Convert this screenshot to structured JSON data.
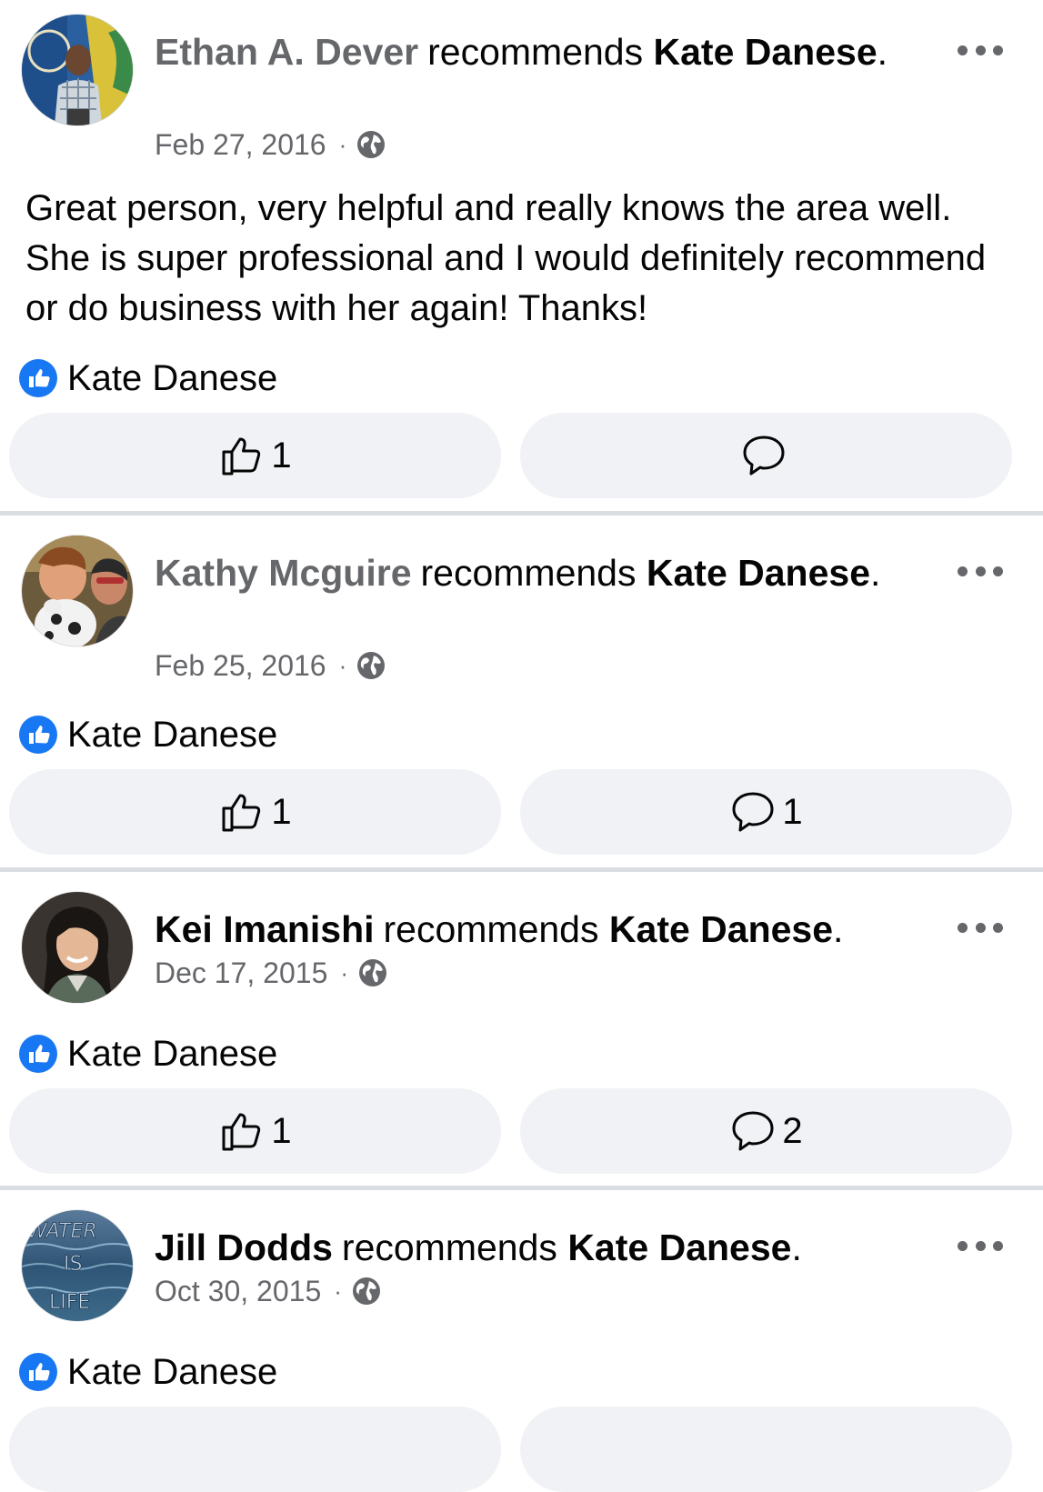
{
  "colors": {
    "accent_blue": "#1877f2",
    "muted_text": "#65676b",
    "button_bg": "#f0f2f5",
    "divider": "#dadde1"
  },
  "posts": [
    {
      "author": "Ethan A. Dever",
      "verb": "recommends",
      "target": "Kate Danese",
      "date": "Feb 27, 2016",
      "privacy_icon": "globe-icon",
      "text": "Great person, very helpful and really knows the area well. She is super professional and I would definitely recommend or do business with her again! Thanks!",
      "recommended_page": "Kate Danese",
      "like_count": "1",
      "comment_count": ""
    },
    {
      "author": "Kathy Mcguire",
      "verb": "recommends",
      "target": "Kate Danese",
      "date": "Feb 25, 2016",
      "privacy_icon": "globe-icon",
      "text": "",
      "recommended_page": "Kate Danese",
      "like_count": "1",
      "comment_count": "1"
    },
    {
      "author": "Kei Imanishi",
      "verb": "recommends",
      "target": "Kate Danese",
      "date": "Dec 17, 2015",
      "privacy_icon": "globe-icon",
      "text": "",
      "recommended_page": "Kate Danese",
      "like_count": "1",
      "comment_count": "2"
    },
    {
      "author": "Jill Dodds",
      "verb": "recommends",
      "target": "Kate Danese",
      "date": "Oct 30, 2015",
      "privacy_icon": "globe-icon",
      "text": "",
      "recommended_page": "Kate Danese",
      "avatar_text": [
        "WATER",
        "IS",
        "LIFE"
      ]
    }
  ]
}
